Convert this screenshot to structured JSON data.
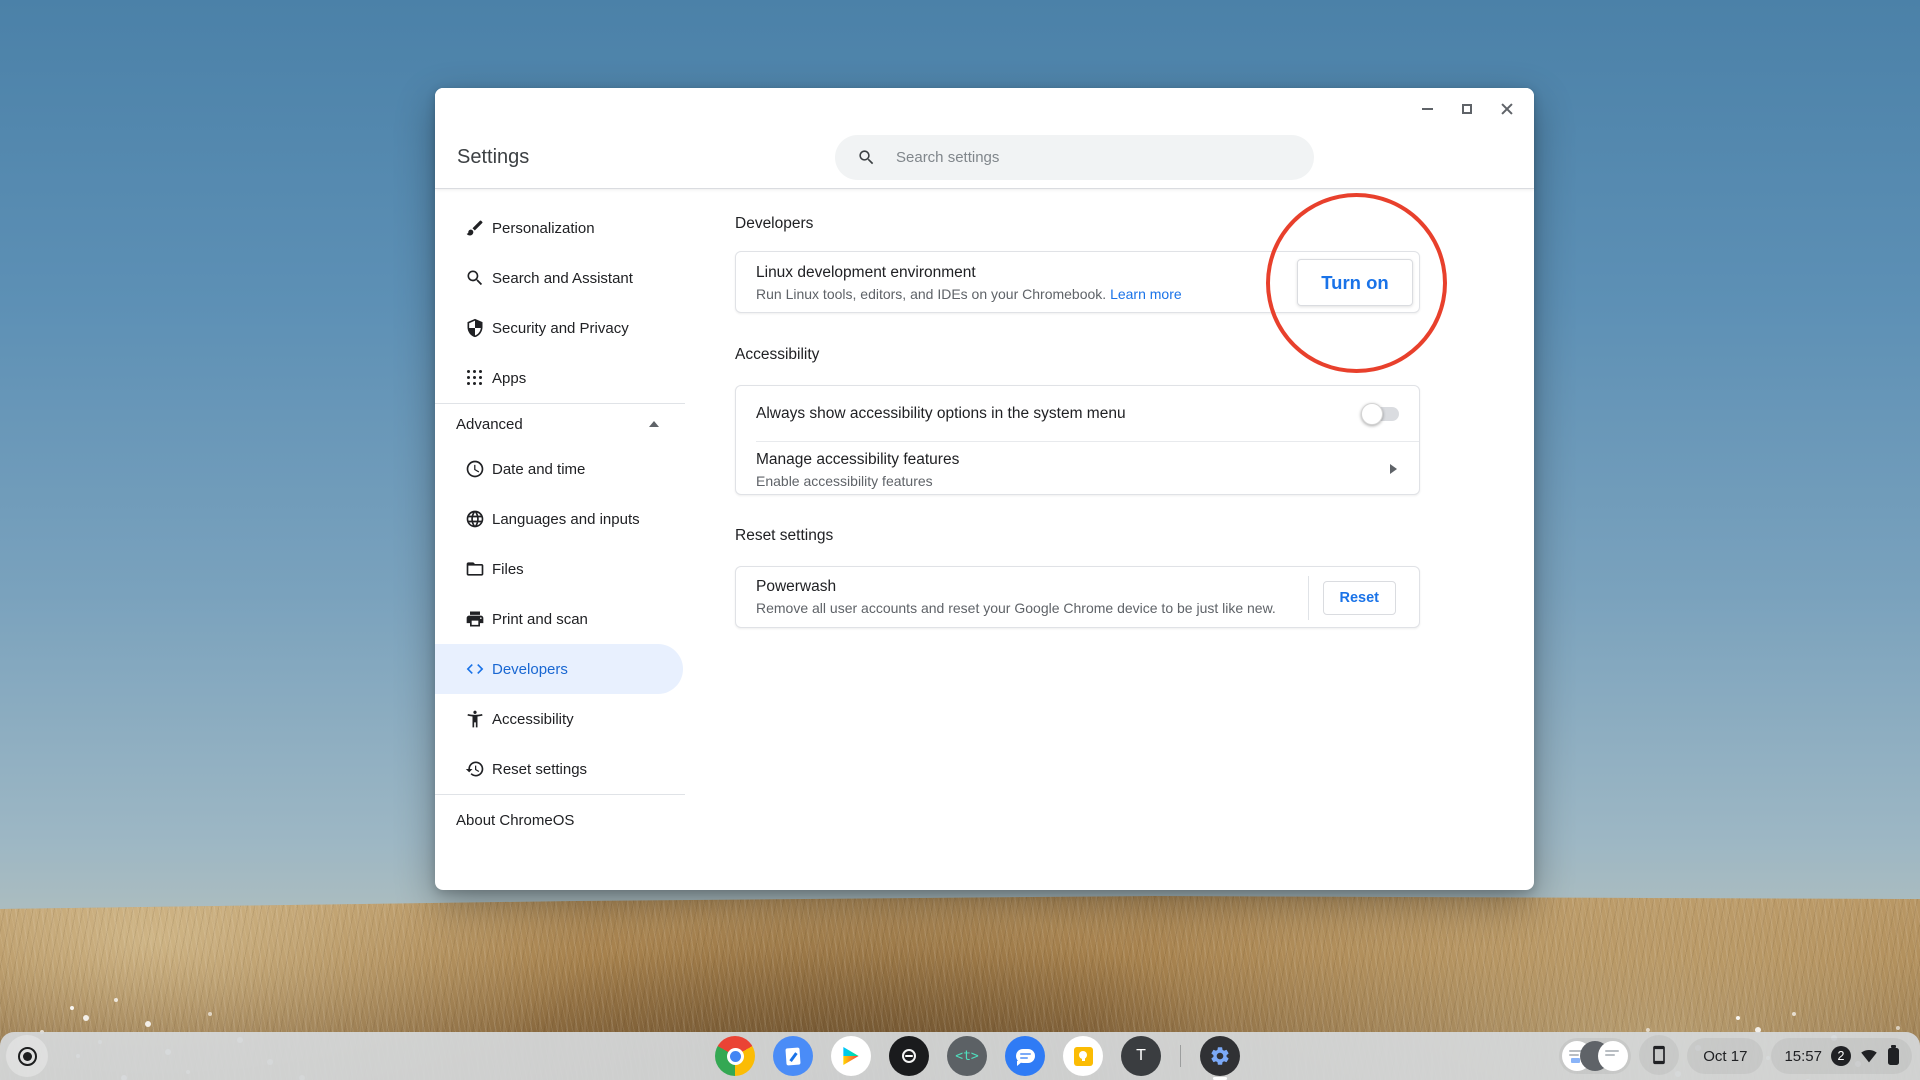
{
  "window": {
    "title": "Settings",
    "search": {
      "placeholder": "Search settings"
    }
  },
  "sidebar": {
    "items": [
      {
        "label": "Personalization",
        "icon": "brush-icon"
      },
      {
        "label": "Search and Assistant",
        "icon": "search-icon"
      },
      {
        "label": "Security and Privacy",
        "icon": "shield-icon"
      },
      {
        "label": "Apps",
        "icon": "apps-grid-icon"
      }
    ],
    "advanced": {
      "label": "Advanced",
      "expanded": true
    },
    "advanced_items": [
      {
        "label": "Date and time",
        "icon": "clock-icon"
      },
      {
        "label": "Languages and inputs",
        "icon": "globe-icon"
      },
      {
        "label": "Files",
        "icon": "folder-icon"
      },
      {
        "label": "Print and scan",
        "icon": "printer-icon"
      },
      {
        "label": "Developers",
        "icon": "code-icon",
        "selected": true
      },
      {
        "label": "Accessibility",
        "icon": "accessibility-icon"
      },
      {
        "label": "Reset settings",
        "icon": "restore-icon"
      }
    ],
    "about": {
      "label": "About ChromeOS"
    }
  },
  "content": {
    "developers_section": {
      "heading": "Developers",
      "linux_row": {
        "title": "Linux development environment",
        "description": "Run Linux tools, editors, and IDEs on your Chromebook.",
        "link_label": "Learn more",
        "button_label": "Turn on"
      }
    },
    "accessibility_section": {
      "heading": "Accessibility",
      "always_show_row": {
        "label": "Always show accessibility options in the system menu",
        "toggle_state": "off"
      },
      "manage_row": {
        "title": "Manage accessibility features",
        "subtitle": "Enable accessibility features"
      }
    },
    "reset_section": {
      "heading": "Reset settings",
      "powerwash_row": {
        "title": "Powerwash",
        "description": "Remove all user accounts and reset your Google Chrome device to be just like new.",
        "button_label": "Reset"
      }
    }
  },
  "annotation": {
    "shape": "ellipse",
    "color": "#e8402c",
    "target": "Turn on button"
  },
  "shelf": {
    "apps": [
      "chrome-icon",
      "notes-app-icon",
      "play-store-icon",
      "dark-logo-app-icon",
      "t-editor-app-icon",
      "messages-icon",
      "keep-icon",
      "avatar-t-icon",
      "settings-gear-icon"
    ],
    "t_app_glyph": "<t>",
    "avatar_letter": "T",
    "status": {
      "date": "Oct 17",
      "time": "15:57",
      "notification_badge": "2"
    }
  },
  "colors": {
    "accent_blue": "#1a73e8",
    "selected_item_bg": "#e8f0fe",
    "annotation_red": "#e8402c",
    "shelf_bg": "#d5d8da",
    "search_bg": "#f1f3f4"
  }
}
